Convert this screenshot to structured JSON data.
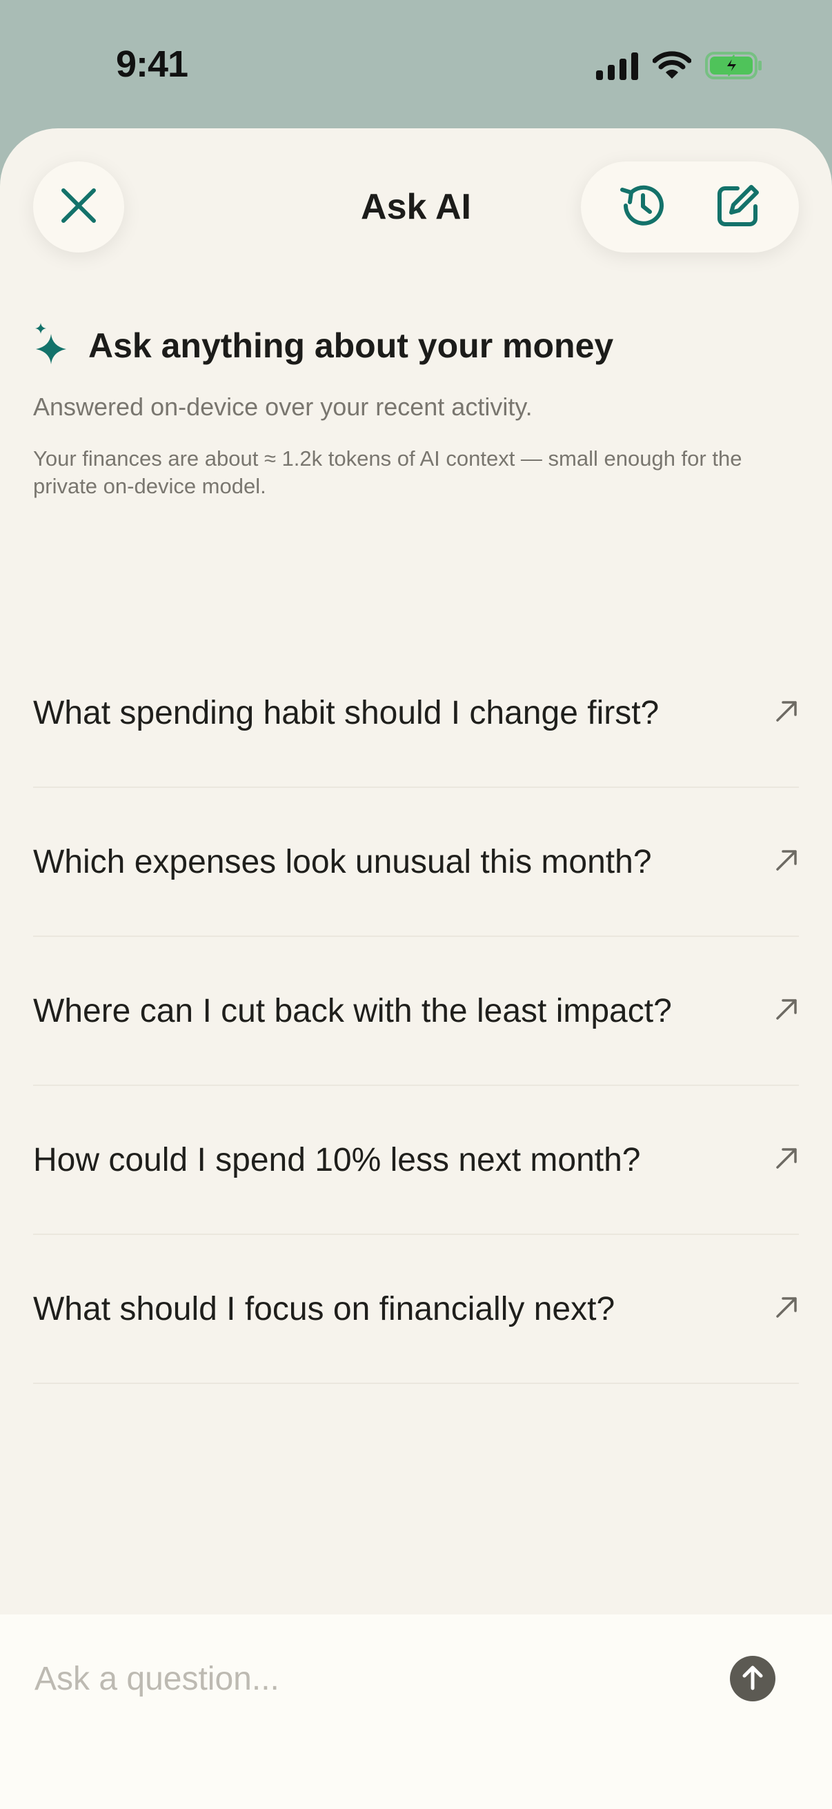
{
  "status_bar": {
    "time": "9:41",
    "icons": [
      "cellular-signal-icon",
      "wifi-icon",
      "battery-charging-icon"
    ]
  },
  "header": {
    "title": "Ask AI",
    "close_icon": "close-icon",
    "history_icon": "history-icon",
    "new_chat_icon": "compose-icon"
  },
  "intro": {
    "icon": "sparkles-icon",
    "title": "Ask anything about your money",
    "subtitle": "Answered on-device over your recent activity.",
    "note": "Your finances are about ≈ 1.2k tokens of AI context — small enough for the private on-device model."
  },
  "suggestions": [
    {
      "label": "What spending habit should I change first?",
      "icon": "arrow-up-right-icon"
    },
    {
      "label": "Which expenses look unusual this month?",
      "icon": "arrow-up-right-icon"
    },
    {
      "label": "Where can I cut back with the least impact?",
      "icon": "arrow-up-right-icon"
    },
    {
      "label": "How could I spend 10% less next month?",
      "icon": "arrow-up-right-icon"
    },
    {
      "label": "What should I focus on financially next?",
      "icon": "arrow-up-right-icon"
    }
  ],
  "composer": {
    "placeholder": "Ask a question...",
    "value": "",
    "send_icon": "arrow-up-icon"
  },
  "colors": {
    "accent": "#13726a",
    "background": "#f6f3ec",
    "top_background": "#a9bcb5",
    "battery": "#4fc35a"
  }
}
